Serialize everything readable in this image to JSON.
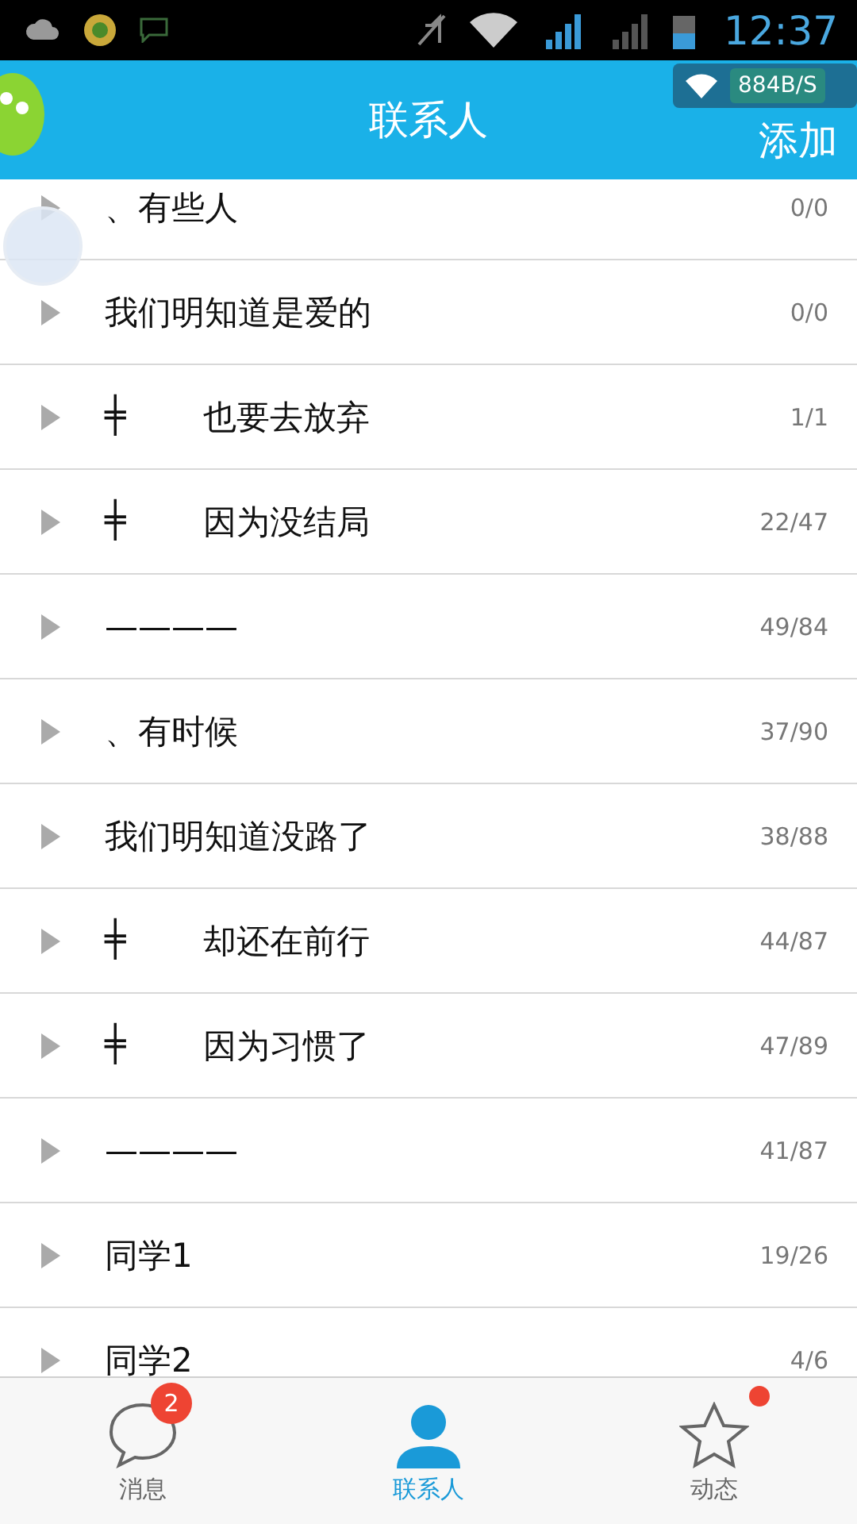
{
  "status_bar": {
    "time": "12:37"
  },
  "header": {
    "title": "联系人",
    "action": "添加",
    "speed": "884B/S"
  },
  "groups": [
    {
      "name": "、有些人",
      "count": "0/0"
    },
    {
      "name": "我们明知道是爱的",
      "count": "0/0"
    },
    {
      "mark": "╪",
      "name": "也要去放弃",
      "count": "1/1"
    },
    {
      "mark": "╪",
      "name": "因为没结局",
      "count": "22/47"
    },
    {
      "name": "————",
      "count": "49/84"
    },
    {
      "name": "、有时候",
      "count": "37/90"
    },
    {
      "name": "我们明知道没路了",
      "count": "38/88"
    },
    {
      "mark": "╪",
      "name": "却还在前行",
      "count": "44/87"
    },
    {
      "mark": "╪",
      "name": "因为习惯了",
      "count": "47/89"
    },
    {
      "name": "————",
      "count": "41/87"
    },
    {
      "name": "同学1",
      "count": "19/26"
    },
    {
      "name": "同学2",
      "count": "4/6"
    }
  ],
  "tabs": [
    {
      "kind": "chat",
      "label": "消息",
      "selected": false,
      "badge": "2",
      "dot": false
    },
    {
      "kind": "person",
      "label": "联系人",
      "selected": true,
      "dot": false
    },
    {
      "kind": "star",
      "label": "动态",
      "selected": false,
      "dot": true
    }
  ]
}
